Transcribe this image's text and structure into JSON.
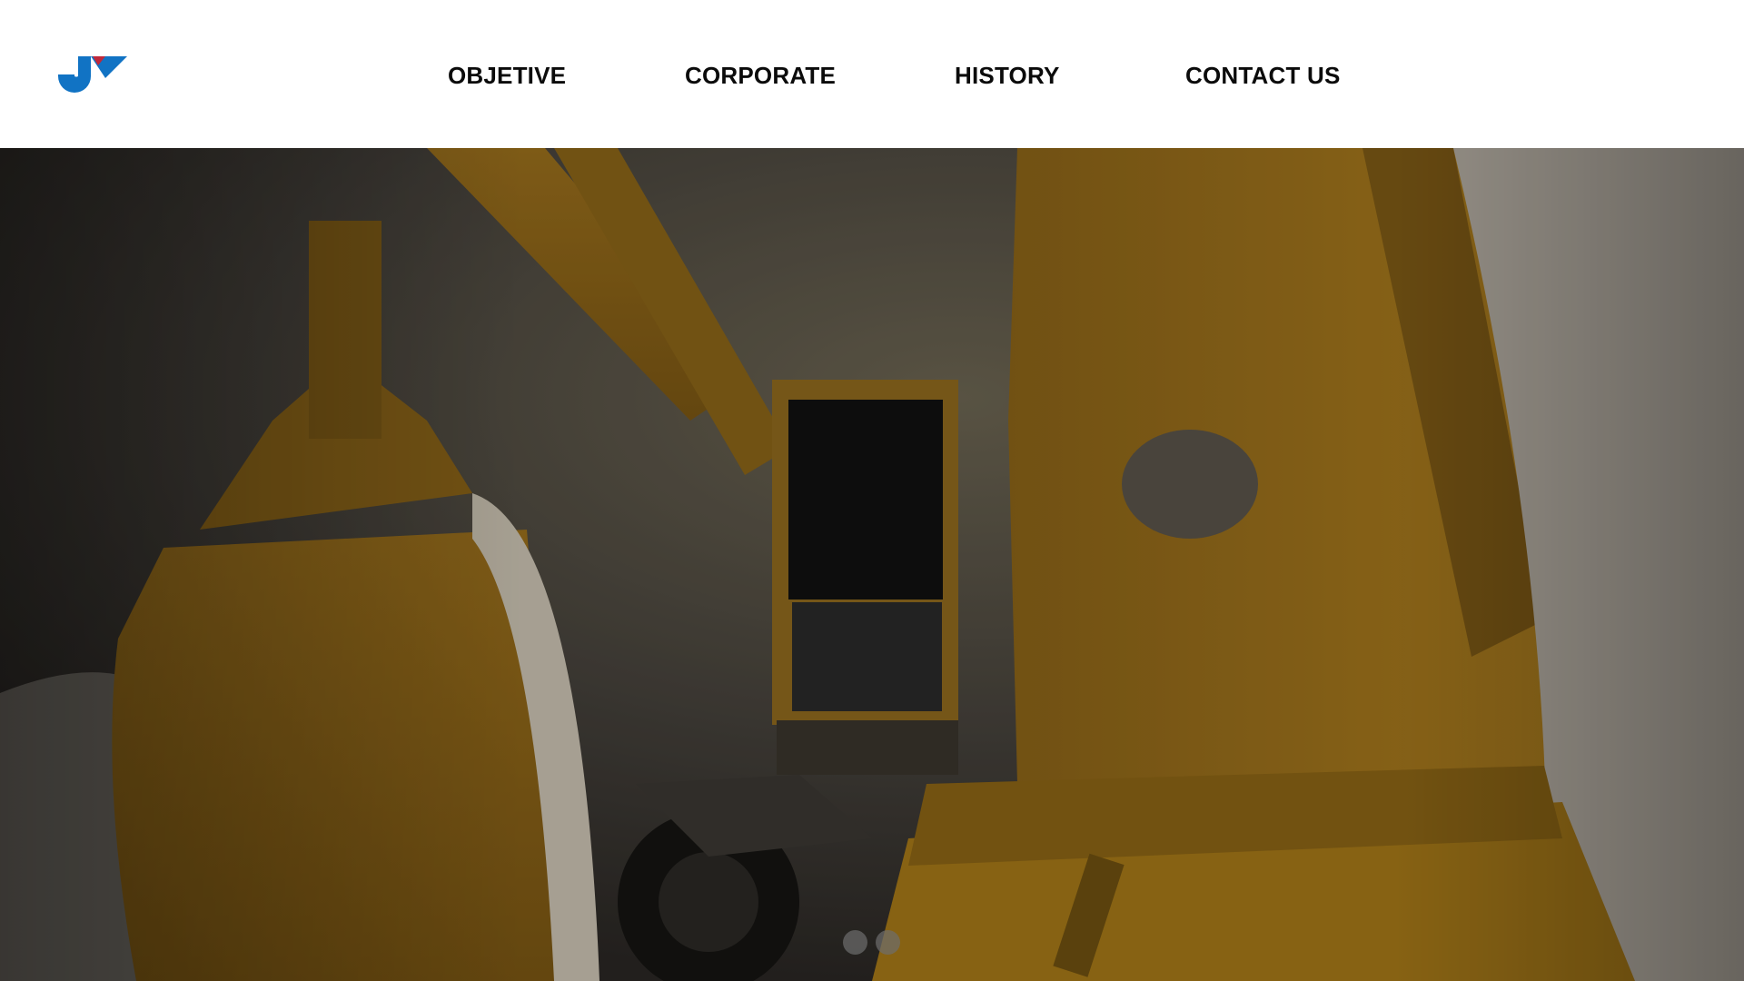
{
  "header": {
    "logo_icon": "company-logo-icon",
    "nav": [
      {
        "label": "OBJETIVE"
      },
      {
        "label": "CORPORATE"
      },
      {
        "label": "HISTORY"
      },
      {
        "label": "CONTACT US"
      }
    ]
  },
  "hero": {
    "image": "excavator-photo",
    "slides_count": 2,
    "active_slide": 1
  },
  "colors": {
    "brand_blue": "#1173c4",
    "brand_red": "#c0283a",
    "nav_text": "#0b0b0b",
    "machine_yellow": "#c28b1a"
  }
}
